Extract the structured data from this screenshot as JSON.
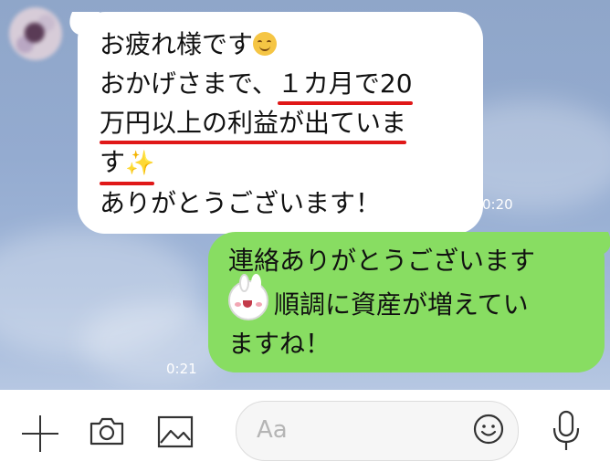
{
  "incoming": {
    "lines": [
      "お疲れ様です",
      "おかげさまで、",
      "１カ月で20",
      "万円以上の利益が出ていま",
      "す",
      "ありがとうございます！"
    ],
    "time": "0:20",
    "emoji_1": "smiling-face-emoji",
    "emoji_2": "sparkles-emoji"
  },
  "outgoing": {
    "lines": [
      "連絡ありがとうございます",
      "順調に資産が増えてい",
      "ますね！"
    ],
    "time": "0:21",
    "sticker": "bunny-sticker-icon"
  },
  "toolbar": {
    "placeholder": "Aa",
    "icons": [
      "plus-icon",
      "camera-icon",
      "image-icon",
      "emoji-icon",
      "microphone-icon"
    ]
  },
  "colors": {
    "incoming_bubble": "#ffffff",
    "outgoing_bubble": "#88dd62",
    "underline": "#e01818",
    "chat_background": "#94abd0"
  }
}
